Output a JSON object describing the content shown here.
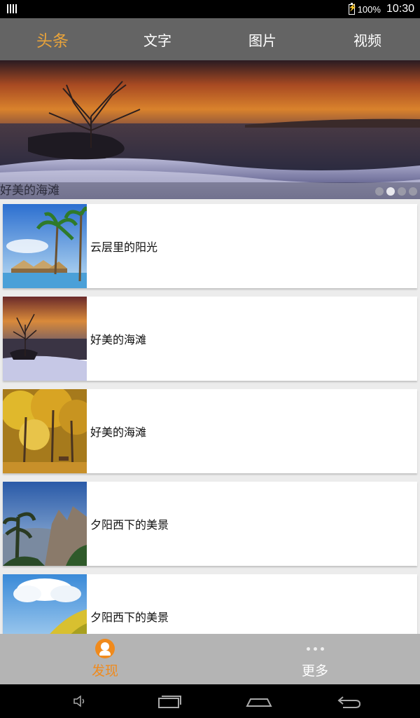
{
  "status_bar": {
    "battery": "100%",
    "time": "10:30"
  },
  "tabs": [
    {
      "label": "头条",
      "active": true
    },
    {
      "label": "文字",
      "active": false
    },
    {
      "label": "图片",
      "active": false
    },
    {
      "label": "视频",
      "active": false
    }
  ],
  "banner": {
    "caption": "好美的海滩",
    "dots": 4,
    "active_dot": 2
  },
  "list_items": [
    {
      "title": "云层里的阳光",
      "thumb": "beach-palm-huts"
    },
    {
      "title": "好美的海滩",
      "thumb": "sunset-tree-beach"
    },
    {
      "title": "好美的海滩",
      "thumb": "autumn-forest"
    },
    {
      "title": "夕阳西下的美景",
      "thumb": "mountain-pines"
    },
    {
      "title": "夕阳西下的美景",
      "thumb": "sky-flowers"
    }
  ],
  "bottom_nav": [
    {
      "label": "发现",
      "icon": "person-circle-icon",
      "active": true
    },
    {
      "label": "更多",
      "icon": "more-dots-icon",
      "active": false
    }
  ],
  "colors": {
    "accent": "#e9a33a",
    "nav_accent": "#f08a1c",
    "top_bar": "#646464",
    "bottom_bar": "#b4b4b4"
  }
}
